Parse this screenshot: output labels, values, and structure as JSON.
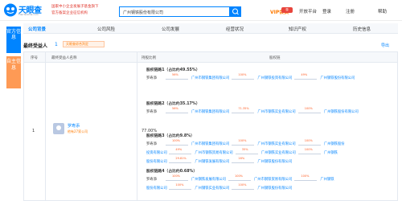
{
  "header": {
    "brand": "天眼查",
    "brand_sub": "TianYanCha.com",
    "slogan_line1": "国家中小企业发展子基金旗下",
    "slogan_line2": "官方备案企业征信机构",
    "search_value": "广州钢铁股份有限公司",
    "vip": "VIP会员",
    "vip_badge": "惠",
    "nav": [
      "开放平台",
      "登录",
      "注册",
      "帮助"
    ]
  },
  "side_tabs": [
    "官方信息",
    "自主信息"
  ],
  "tabs": [
    "公司背景",
    "公司风险",
    "公司发展",
    "经营状况",
    "知识产权",
    "历史信息"
  ],
  "section": {
    "title": "最终受益人",
    "count": "1",
    "badge": "天眼查综合判定",
    "link": "导出"
  },
  "table": {
    "headers": [
      "序号",
      "最终受益人名称",
      "持股比例",
      "股权链"
    ],
    "row": {
      "index": "1",
      "name": "罗寿添",
      "sub": "他有27家公司",
      "share": "77.00%"
    },
    "groups": [
      {
        "title": "股权链路1（占比约49.55%）",
        "chains": [
          [
            "罗寿添",
            "56%",
            "广州市钢铁集团有限公司",
            "100%",
            "广州钢铁投资有限公司",
            "49%",
            "广州钢铁股份有限公司"
          ]
        ]
      },
      {
        "title": "股权链路2（占比约35.17%）",
        "chains": [
          [
            "罗寿添",
            "56%",
            "广州市钢铁集团有限公司",
            "71.35%",
            "广州市钢铁实业有限公司",
            "100%",
            "广州钢铁股份有限公司"
          ]
        ]
      },
      {
        "title": "股权链路3（占比约9.8%）",
        "chains": [
          [
            "罗寿添",
            "100%",
            "广州市钢铁集团有限公司",
            "100%",
            "广州市钢铁实业有限公司",
            "100%",
            "广州钢铁股份"
          ],
          [
            "投资有限公司",
            "49%",
            "广州市钢铁贸易有限公司",
            "35%",
            "广州钢铁实业有限公司",
            "100%",
            "广州钢铁"
          ],
          [
            "股份有限公司",
            "29.81%",
            "广州钢铁发展有限公司",
            "16%",
            "广州钢铁股份有限公司"
          ]
        ]
      },
      {
        "title": "股权链路4（占比约0.68%）",
        "chains": [
          [
            "罗寿添",
            "100%",
            "广州钢铁发展有限公司",
            "100%",
            "广州市钢铁贸易有限公司",
            "100%",
            "广州钢铁"
          ],
          [
            "股份有限公司",
            "100%",
            "广州钢铁实业有限公司",
            "100%",
            "广州钢铁股份有限公司"
          ]
        ]
      }
    ]
  },
  "colors": {
    "accent": "#0084ff",
    "warn": "#ff7a00",
    "pct": "#ff5a1f"
  }
}
